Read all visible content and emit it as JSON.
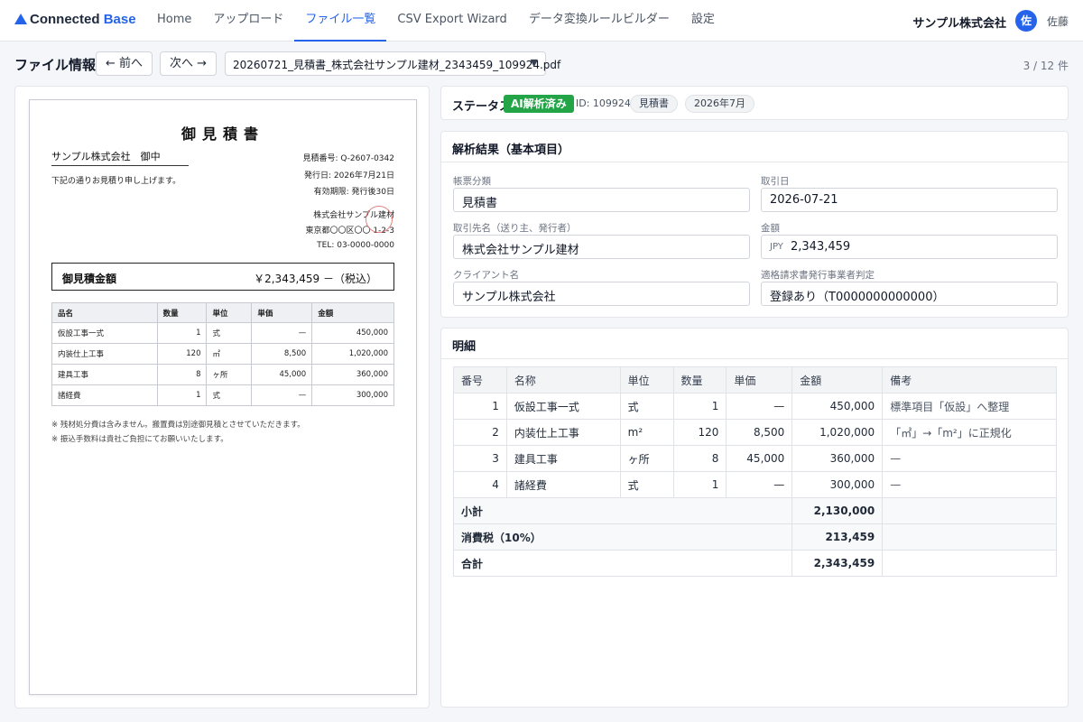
{
  "nav": {
    "logo_prefix": "Connected",
    "logo_accent": "Base",
    "tabs": [
      {
        "label": "Home",
        "active": false
      },
      {
        "label": "アップロード",
        "active": false
      },
      {
        "label": "ファイル一覧",
        "active": true
      },
      {
        "label": "CSV Export Wizard",
        "active": false
      },
      {
        "label": "データ変換ルールビルダー",
        "active": false
      },
      {
        "label": "設定",
        "active": false
      }
    ],
    "company": "サンプル株式会社",
    "avatar_initial": "佐",
    "user_name": "佐藤"
  },
  "toolbar": {
    "title": "ファイル情報",
    "prev_label": "← 前へ",
    "next_label": "次へ →",
    "file_name": "20260721_見積書_株式会社サンプル建材_2343459_109924.pdf",
    "pager": "3 / 12 件"
  },
  "preview": {
    "title": "御見積書",
    "client": "サンプル株式会社　御中",
    "intro": "下記の通りお見積り申し上げます。",
    "quote_no": "見積番号: Q-2607-0342",
    "issue_date": "発行日: 2026年7月21日",
    "validity": "有効期限: 発行後30日",
    "issuer_name": "株式会社サンプル建材",
    "issuer_address": "東京都〇〇区〇〇 1-2-3",
    "issuer_tel": "TEL: 03-0000-0000",
    "total_label": "御見積金額",
    "total_value": "￥2,343,459 －（税込）",
    "headers": [
      "品名",
      "数量",
      "単位",
      "単価",
      "金額"
    ],
    "rows": [
      [
        "仮設工事一式",
        "1",
        "式",
        "—",
        "450,000"
      ],
      [
        "内装仕上工事",
        "120",
        "㎡",
        "8,500",
        "1,020,000"
      ],
      [
        "建具工事",
        "8",
        "ヶ所",
        "45,000",
        "360,000"
      ],
      [
        "諸経費",
        "1",
        "式",
        "—",
        "300,000"
      ]
    ],
    "note1": "※ 残材処分費は含みません。搬置費は別途御見積とさせていただきます。",
    "note2": "※ 振込手数料は貴社ご負担にてお願いいたします。"
  },
  "status": {
    "label": "ステータス",
    "badge": "AI解析済み",
    "doc_id": "ID: 109924",
    "tag1": "見積書",
    "tag2": "2026年7月"
  },
  "basic": {
    "heading": "解析結果（基本項目）",
    "fields": {
      "doc_type": {
        "label": "帳票分類",
        "value": "見積書"
      },
      "trade_date": {
        "label": "取引日",
        "value": "2026-07-21"
      },
      "partner": {
        "label": "取引先名（送り主、発行者）",
        "value": "株式会社サンプル建材"
      },
      "amount": {
        "label": "金額",
        "currency": "JPY",
        "value": "2,343,459"
      },
      "client": {
        "label": "クライアント名",
        "value": "サンプル株式会社"
      },
      "invoice_reg": {
        "label": "適格請求書発行事業者判定",
        "value": "登録あり（T0000000000000）"
      }
    }
  },
  "detail": {
    "heading": "明細",
    "headers": [
      "番号",
      "名称",
      "単位",
      "数量",
      "単価",
      "金額",
      "備考"
    ],
    "rows": [
      [
        "1",
        "仮設工事一式",
        "式",
        "1",
        "—",
        "450,000",
        "標準項目「仮設」へ整理"
      ],
      [
        "2",
        "内装仕上工事",
        "m²",
        "120",
        "8,500",
        "1,020,000",
        "「㎡」→「m²」に正規化"
      ],
      [
        "3",
        "建具工事",
        "ヶ所",
        "8",
        "45,000",
        "360,000",
        "—"
      ],
      [
        "4",
        "諸経費",
        "式",
        "1",
        "—",
        "300,000",
        "—"
      ]
    ],
    "subtotal": {
      "label": "小計",
      "value": "2,130,000"
    },
    "tax": {
      "label": "消費税（10%）",
      "value": "213,459"
    },
    "total": {
      "label": "合計",
      "value": "2,343,459"
    }
  },
  "colors": {
    "accent": "#2563eb",
    "badge_green": "#22a447",
    "stamp_red": "#e26b6b"
  }
}
